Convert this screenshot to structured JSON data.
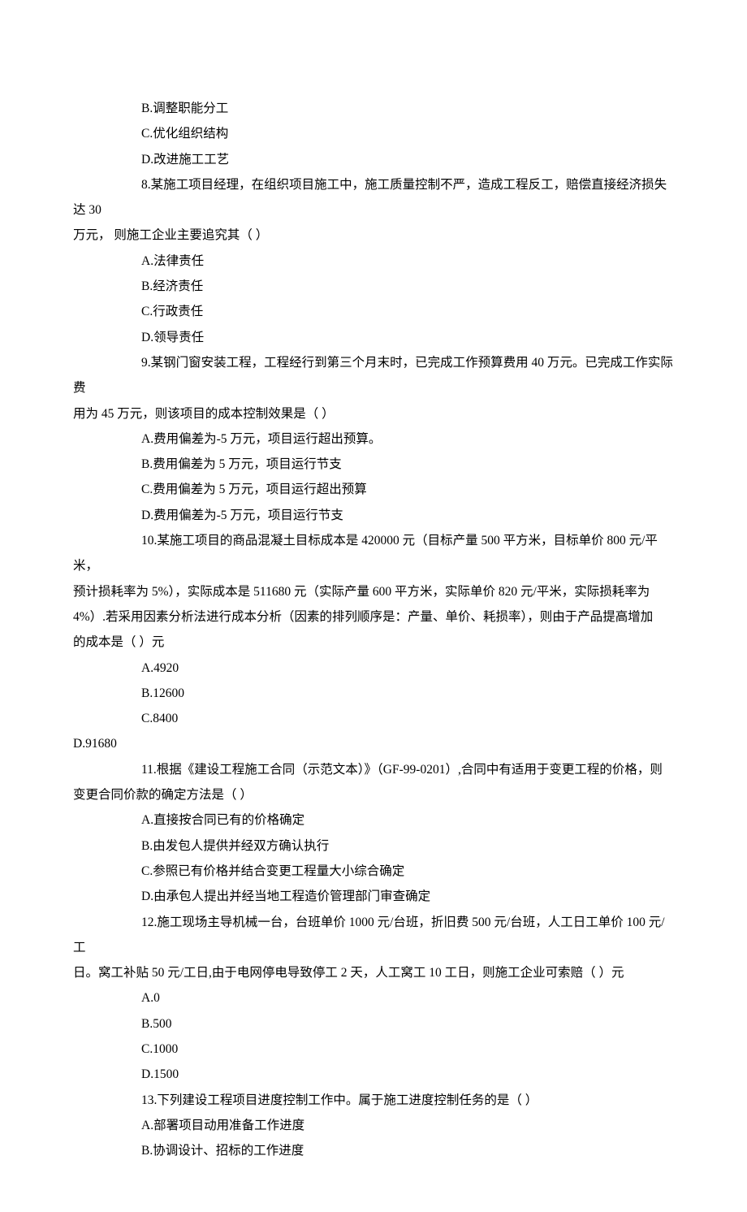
{
  "lines": [
    {
      "cls": "opt",
      "bind": "o07b"
    },
    {
      "cls": "opt",
      "bind": "o07c"
    },
    {
      "cls": "opt",
      "bind": "o07d"
    },
    {
      "cls": "qstart",
      "bind": "q08a"
    },
    {
      "cls": "cont",
      "bind": "q08b"
    },
    {
      "cls": "opt",
      "bind": "o08a"
    },
    {
      "cls": "opt",
      "bind": "o08b"
    },
    {
      "cls": "opt",
      "bind": "o08c"
    },
    {
      "cls": "opt",
      "bind": "o08d"
    },
    {
      "cls": "qstart",
      "bind": "q09a"
    },
    {
      "cls": "cont",
      "bind": "q09b"
    },
    {
      "cls": "opt",
      "bind": "o09a"
    },
    {
      "cls": "opt",
      "bind": "o09b"
    },
    {
      "cls": "opt",
      "bind": "o09c"
    },
    {
      "cls": "opt",
      "bind": "o09d"
    },
    {
      "cls": "qstart",
      "bind": "q10a"
    },
    {
      "cls": "cont",
      "bind": "q10b"
    },
    {
      "cls": "cont",
      "bind": "q10c"
    },
    {
      "cls": "cont",
      "bind": "q10d"
    },
    {
      "cls": "opt",
      "bind": "o10a"
    },
    {
      "cls": "opt",
      "bind": "o10b"
    },
    {
      "cls": "opt",
      "bind": "o10c"
    },
    {
      "cls": "opt-d",
      "bind": "o10d"
    },
    {
      "cls": "qstart",
      "bind": "q11a"
    },
    {
      "cls": "cont",
      "bind": "q11b"
    },
    {
      "cls": "opt",
      "bind": "o11a"
    },
    {
      "cls": "opt",
      "bind": "o11b"
    },
    {
      "cls": "opt",
      "bind": "o11c"
    },
    {
      "cls": "opt",
      "bind": "o11d"
    },
    {
      "cls": "qstart",
      "bind": "q12a"
    },
    {
      "cls": "cont",
      "bind": "q12b"
    },
    {
      "cls": "opt",
      "bind": "o12a"
    },
    {
      "cls": "opt",
      "bind": "o12b"
    },
    {
      "cls": "opt",
      "bind": "o12c"
    },
    {
      "cls": "opt",
      "bind": "o12d"
    },
    {
      "cls": "qstart",
      "bind": "q13a"
    },
    {
      "cls": "opt",
      "bind": "o13a"
    },
    {
      "cls": "opt",
      "bind": "o13b"
    }
  ],
  "text": {
    "o07b": "B.调整职能分工",
    "o07c": "C.优化组织结构",
    "o07d": "D.改进施工工艺",
    "q08a": "8.某施工项目经理，在组织项目施工中，施工质量控制不严，造成工程反工，赔偿直接经济损失达 30",
    "q08b": "万元， 则施工企业主要追究其（ ）",
    "o08a": "A.法律责任",
    "o08b": "B.经济责任",
    "o08c": "C.行政责任",
    "o08d": "D.领导责任",
    "q09a": "9.某钢门窗安装工程，工程经行到第三个月末时，已完成工作预算费用 40 万元。已完成工作实际费",
    "q09b": "用为 45 万元，则该项目的成本控制效果是（ ）",
    "o09a": "A.费用偏差为-5 万元，项目运行超出预算。",
    "o09b": "B.费用偏差为 5 万元，项目运行节支",
    "o09c": "C.费用偏差为 5 万元，项目运行超出预算",
    "o09d": "D.费用偏差为-5 万元，项目运行节支",
    "q10a": "10.某施工项目的商品混凝土目标成本是 420000 元（目标产量 500 平方米，目标单价 800 元/平米，",
    "q10b": "预计损耗率为 5%），实际成本是 511680 元（实际产量 600 平方米，实际单价 820 元/平米，实际损耗率为",
    "q10c": "4%）.若采用因素分析法进行成本分析（因素的排列顺序是：产量、单价、耗损率），则由于产品提高增加",
    "q10d": "的成本是（ ）元",
    "o10a": "A.4920",
    "o10b": "B.12600",
    "o10c": "C.8400",
    "o10d": "D.91680",
    "q11a": "11.根据《建设工程施工合同（示范文本）》（GF-99-0201）,合同中有适用于变更工程的价格，则",
    "q11b": "变更合同价款的确定方法是（ ）",
    "o11a": "A.直接按合同已有的价格确定",
    "o11b": "B.由发包人提供并经双方确认执行",
    "o11c": "C.参照已有价格并结合变更工程量大小综合确定",
    "o11d": "D.由承包人提出并经当地工程造价管理部门审查确定",
    "q12a": "12.施工现场主导机械一台，台班单价 1000 元/台班，折旧费 500 元/台班，人工日工单价 100 元/工",
    "q12b": "日。窝工补贴 50 元/工日,由于电网停电导致停工 2 天，人工窝工 10 工日，则施工企业可索赔（ ）元",
    "o12a": "A.0",
    "o12b": "B.500",
    "o12c": "C.1000",
    "o12d": "D.1500",
    "q13a": "13.下列建设工程项目进度控制工作中。属于施工进度控制任务的是（ ）",
    "o13a": "A.部署项目动用准备工作进度",
    "o13b": "B.协调设计、招标的工作进度"
  }
}
